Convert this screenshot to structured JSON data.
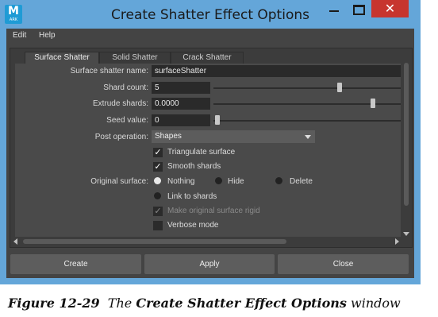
{
  "window": {
    "title": "Create Shatter Effect Options",
    "app_icon": {
      "letter": "M",
      "sub": "ARK"
    },
    "close_glyph": "✕"
  },
  "menu": [
    "Edit",
    "Help"
  ],
  "tabs": [
    "Surface Shatter",
    "Solid Shatter",
    "Crack Shatter"
  ],
  "form": {
    "name": {
      "label": "Surface shatter name:",
      "value": "surfaceShatter"
    },
    "shard_count": {
      "label": "Shard count:",
      "value": "5",
      "slider": 0.68
    },
    "extrude_shards": {
      "label": "Extrude shards:",
      "value": "0.0000",
      "slider": 0.86
    },
    "seed_value": {
      "label": "Seed value:",
      "value": "0",
      "slider": 0.01
    },
    "post_operation": {
      "label": "Post operation:",
      "value": "Shapes"
    },
    "triangulate": {
      "label": "Triangulate surface",
      "checked": true
    },
    "smooth": {
      "label": "Smooth shards",
      "checked": true
    },
    "original_surface": {
      "label": "Original surface:",
      "options": [
        "Nothing",
        "Hide",
        "Delete"
      ],
      "selected": "Nothing"
    },
    "link": {
      "label": "Link to shards"
    },
    "make_rigid": {
      "label": "Make original surface rigid",
      "checked": true,
      "enabled": false
    },
    "verbose": {
      "label": "Verbose mode",
      "checked": false
    }
  },
  "buttons": {
    "create": "Create",
    "apply": "Apply",
    "close": "Close"
  },
  "caption": {
    "figure": "Figure 12-29",
    "pre": "The",
    "bold": "Create Shatter Effect Options",
    "post": "window"
  },
  "colors": {
    "titlebar": "#64a6d9",
    "close_button": "#c7352e",
    "panel": "#444444"
  }
}
